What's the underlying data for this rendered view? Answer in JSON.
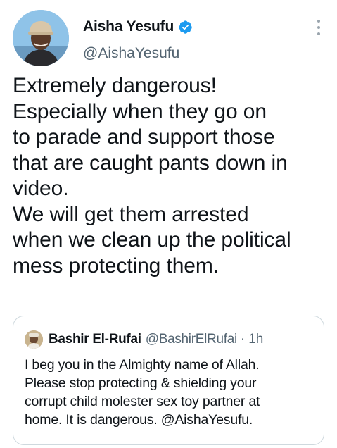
{
  "tweet": {
    "author": {
      "display_name": "Aisha Yesufu",
      "handle": "@AishaYesufu",
      "verified": true,
      "avatar_icon": "profile-photo",
      "verified_icon": "verified-badge-icon"
    },
    "more_icon": "more-vertical-icon",
    "text": "Extremely dangerous!\nEspecially when they go on\nto parade and support those\nthat are caught pants down in\nvideo.\nWe will get them arrested\nwhen we clean up the political\nmess protecting them.",
    "quoted": {
      "display_name": "Bashir El-Rufai",
      "handle": "@BashirElRufai",
      "separator": "·",
      "time": "1h",
      "avatar_icon": "profile-photo",
      "text": "I beg you in the Almighty name of Allah.\nPlease stop protecting & shielding your\ncorrupt child molester sex toy partner at\nhome. It is dangerous. @AishaYesufu."
    }
  },
  "colors": {
    "text_primary": "#0f1419",
    "text_secondary": "#536471",
    "verified_blue": "#1d9bf0",
    "border": "#cfd9de"
  }
}
